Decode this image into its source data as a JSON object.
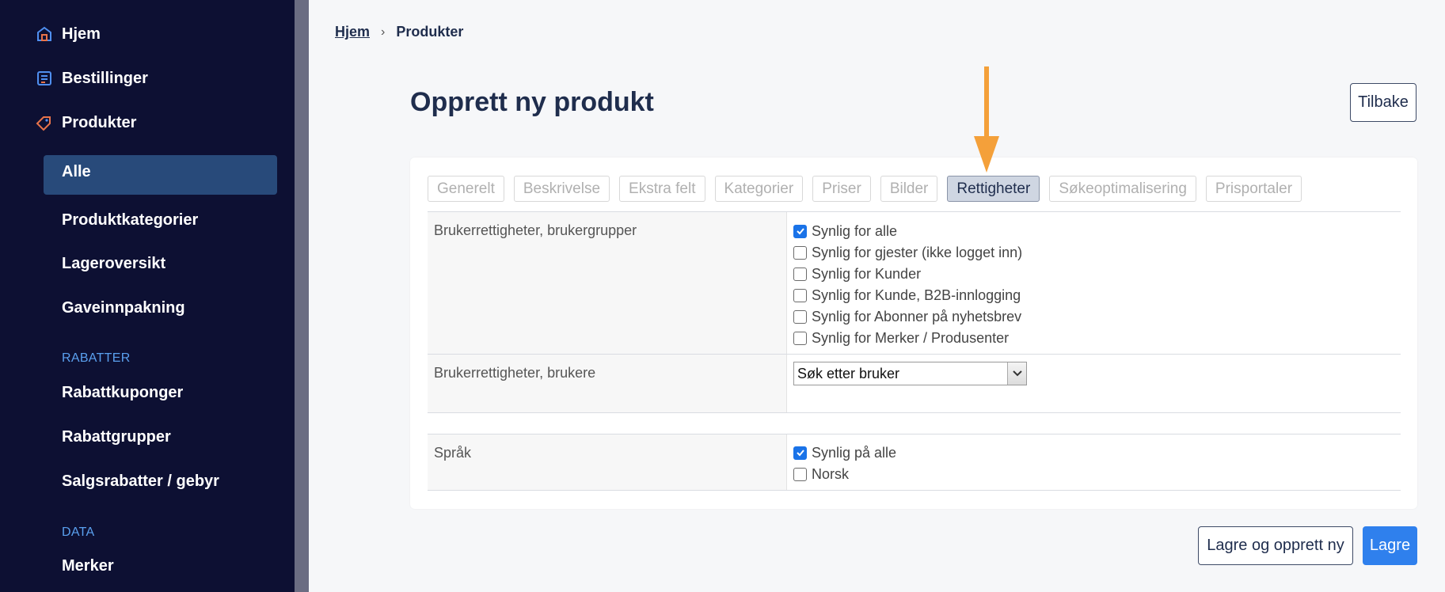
{
  "sidebar": {
    "top_items": [
      {
        "label": "Hjem",
        "icon": "home-icon"
      },
      {
        "label": "Bestillinger",
        "icon": "orders-icon"
      },
      {
        "label": "Produkter",
        "icon": "tag-icon"
      }
    ],
    "product_sub": [
      "Alle",
      "Produktkategorier",
      "Lageroversikt",
      "Gaveinnpakning"
    ],
    "section_rabatter": "RABATTER",
    "rabatter_items": [
      "Rabattkuponger",
      "Rabattgrupper",
      "Salgsrabatter / gebyr"
    ],
    "section_data": "DATA",
    "data_items": [
      "Merker"
    ]
  },
  "breadcrumb": {
    "home": "Hjem",
    "current": "Produkter"
  },
  "page": {
    "title": "Opprett ny produkt",
    "back_label": "Tilbake"
  },
  "tabs": [
    "Generelt",
    "Beskrivelse",
    "Ekstra felt",
    "Kategorier",
    "Priser",
    "Bilder",
    "Rettigheter",
    "Søkeoptimalisering",
    "Prisportaler"
  ],
  "active_tab": "Rettigheter",
  "user_groups": {
    "label": "Brukerrettigheter, brukergrupper",
    "options": [
      {
        "label": "Synlig for alle",
        "checked": true
      },
      {
        "label": "Synlig for gjester (ikke logget inn)",
        "checked": false
      },
      {
        "label": "Synlig for Kunder",
        "checked": false
      },
      {
        "label": "Synlig for Kunde, B2B-innlogging",
        "checked": false
      },
      {
        "label": "Synlig for Abonner på nyhetsbrev",
        "checked": false
      },
      {
        "label": "Synlig for Merker / Produsenter",
        "checked": false
      }
    ]
  },
  "users": {
    "label": "Brukerrettigheter, brukere",
    "select_value": "Søk etter bruker"
  },
  "language": {
    "label": "Språk",
    "options": [
      {
        "label": "Synlig på alle",
        "checked": true
      },
      {
        "label": "Norsk",
        "checked": false
      }
    ]
  },
  "footer": {
    "save_new_label": "Lagre og opprett ny",
    "save_label": "Lagre"
  },
  "colors": {
    "sidebar_bg": "#0d1033",
    "accent": "#2f80ed",
    "arrow": "#f4a03a"
  }
}
